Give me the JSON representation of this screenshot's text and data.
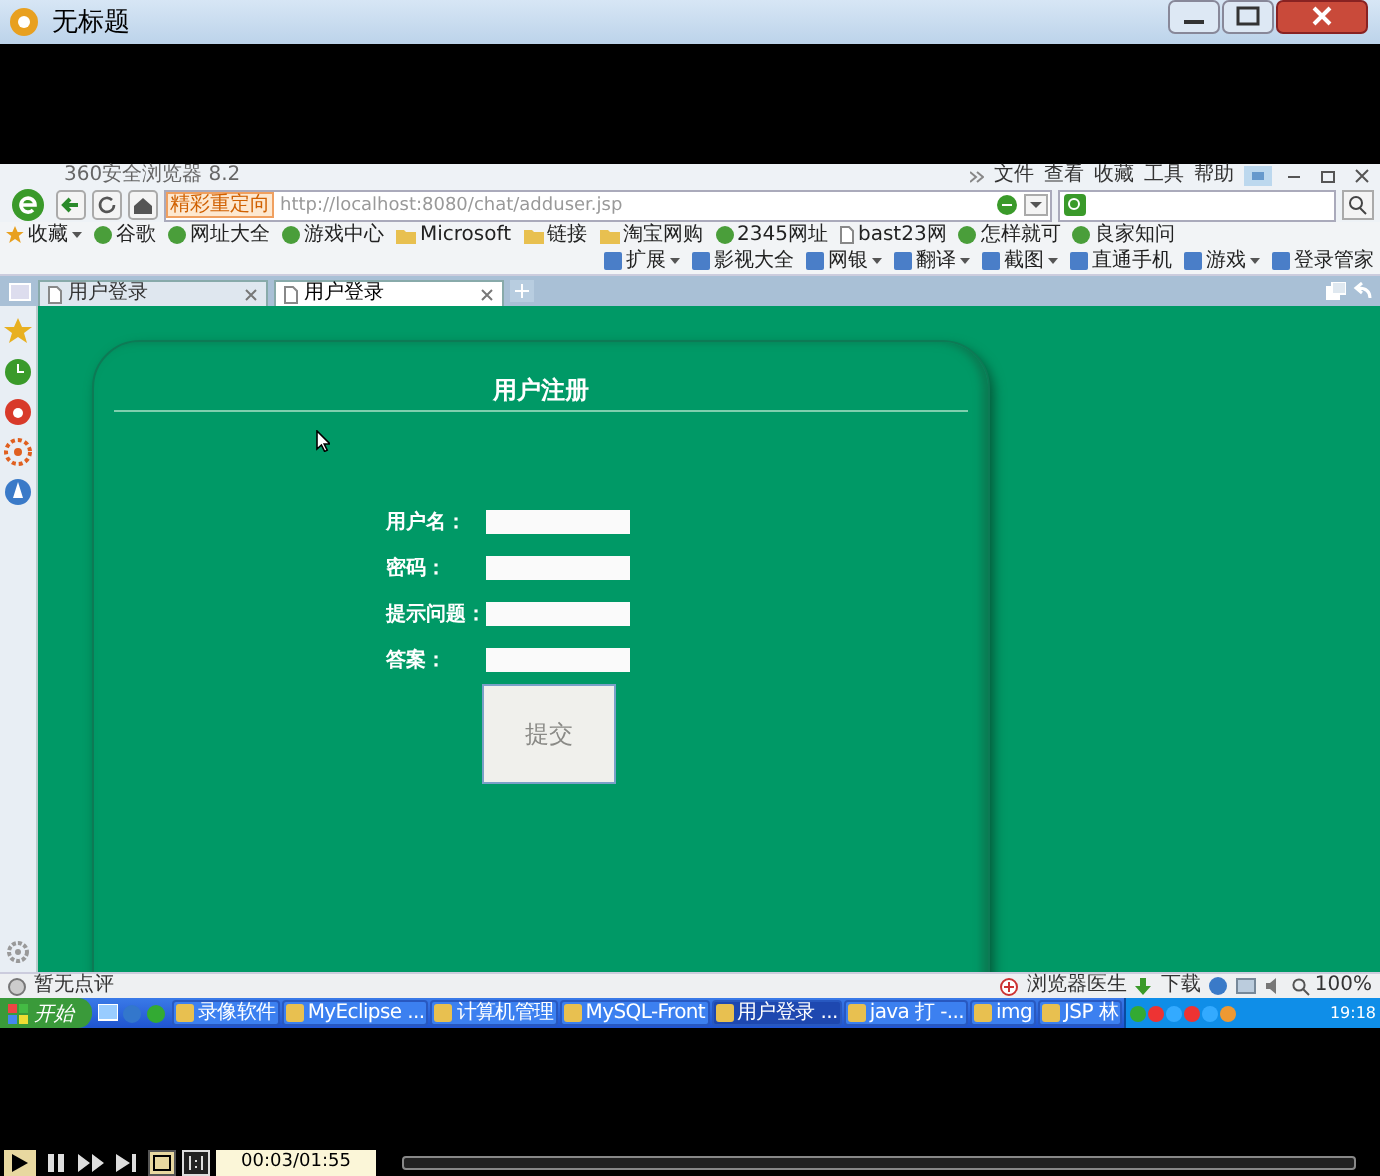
{
  "player_window": {
    "title": "无标题"
  },
  "browser": {
    "title": "360安全浏览器 8.2",
    "menu": [
      "文件",
      "查看",
      "收藏",
      "工具",
      "帮助"
    ],
    "address": {
      "badge": "精彩重定向",
      "url": "http://localhost:8080/chat/adduser.jsp"
    },
    "bookmarks": [
      {
        "label": "收藏",
        "kind": "star",
        "has_menu": true
      },
      {
        "label": "谷歌",
        "kind": "site",
        "has_menu": false
      },
      {
        "label": "网址大全",
        "kind": "site",
        "has_menu": false
      },
      {
        "label": "游戏中心",
        "kind": "site",
        "has_menu": false
      },
      {
        "label": "Microsoft",
        "kind": "folder",
        "has_menu": false
      },
      {
        "label": "链接",
        "kind": "folder",
        "has_menu": false
      },
      {
        "label": "淘宝网购",
        "kind": "folder",
        "has_menu": false
      },
      {
        "label": "2345网址",
        "kind": "site",
        "has_menu": false
      },
      {
        "label": "bast23网",
        "kind": "page",
        "has_menu": false
      },
      {
        "label": "怎样就可",
        "kind": "site",
        "has_menu": false
      },
      {
        "label": "良家知问",
        "kind": "site",
        "has_menu": false
      }
    ],
    "tools": [
      {
        "label": "扩展",
        "has_menu": true
      },
      {
        "label": "影视大全",
        "has_menu": false
      },
      {
        "label": "网银",
        "has_menu": true
      },
      {
        "label": "翻译",
        "has_menu": true
      },
      {
        "label": "截图",
        "has_menu": true
      },
      {
        "label": "直通手机",
        "has_menu": false
      },
      {
        "label": "游戏",
        "has_menu": true
      },
      {
        "label": "登录管家",
        "has_menu": false
      }
    ],
    "tabs": [
      {
        "label": "用户登录",
        "selected": false
      },
      {
        "label": "用户登录",
        "selected": true
      }
    ],
    "status_bar": {
      "left": "暂无点评",
      "doctor": "浏览器医生",
      "download": "下载",
      "zoom": "100%"
    }
  },
  "page": {
    "title": "用户注册",
    "fields": [
      {
        "label": "用户名："
      },
      {
        "label": "密码："
      },
      {
        "label": "提示问题："
      },
      {
        "label": "答案："
      }
    ],
    "submit": {
      "label": "提交",
      "disabled": true
    }
  },
  "taskbar": {
    "start": "开始",
    "tasks": [
      {
        "label": "录像软件",
        "selected": false
      },
      {
        "label": "MyEclipse ...",
        "selected": false
      },
      {
        "label": "计算机管理",
        "selected": false
      },
      {
        "label": "MySQL-Front",
        "selected": false
      },
      {
        "label": "用户登录 ...",
        "selected": true
      },
      {
        "label": "java 打 -...",
        "selected": false
      },
      {
        "label": "img",
        "selected": false
      },
      {
        "label": "JSP 林",
        "selected": false
      }
    ],
    "clock": "19:18"
  },
  "player": {
    "time": "00:03/01:55"
  }
}
